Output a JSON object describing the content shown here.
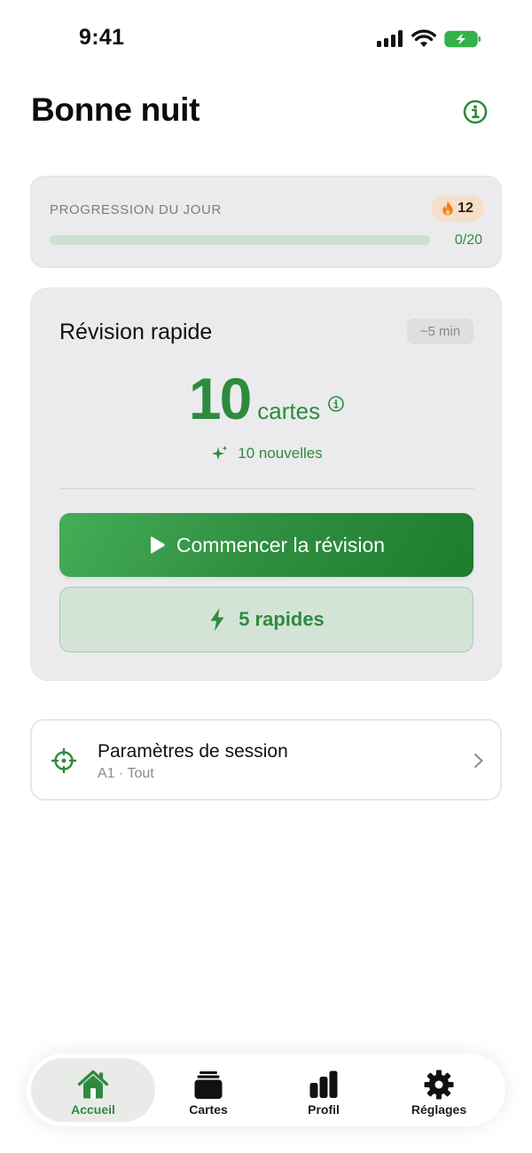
{
  "status_bar": {
    "time": "9:41"
  },
  "header": {
    "title": "Bonne nuit",
    "info_icon": "info-circle-icon"
  },
  "daily_progress": {
    "label": "PROGRESSION DU JOUR",
    "streak": "12",
    "streak_icon": "flame-icon",
    "count": "0/20",
    "progress_fraction": 0
  },
  "review": {
    "title": "Révision rapide",
    "duration": "~5 min",
    "card_count": "10",
    "card_unit": "cartes",
    "new_cards": "10 nouvelles",
    "start_label": "Commencer la révision",
    "quick_label": "5 rapides"
  },
  "session_settings": {
    "title": "Paramètres de session",
    "subtitle": "A1 · Tout",
    "icon": "target-icon"
  },
  "tabs": [
    {
      "label": "Accueil",
      "icon": "home-icon",
      "active": true
    },
    {
      "label": "Cartes",
      "icon": "cards-icon",
      "active": false
    },
    {
      "label": "Profil",
      "icon": "bar-chart-icon",
      "active": false
    },
    {
      "label": "Réglages",
      "icon": "gear-icon",
      "active": false
    }
  ],
  "colors": {
    "accent": "#2e8b3d",
    "card_background": "#ebebed",
    "streak_badge": "#f5dfc9",
    "battery": "#33b249"
  }
}
